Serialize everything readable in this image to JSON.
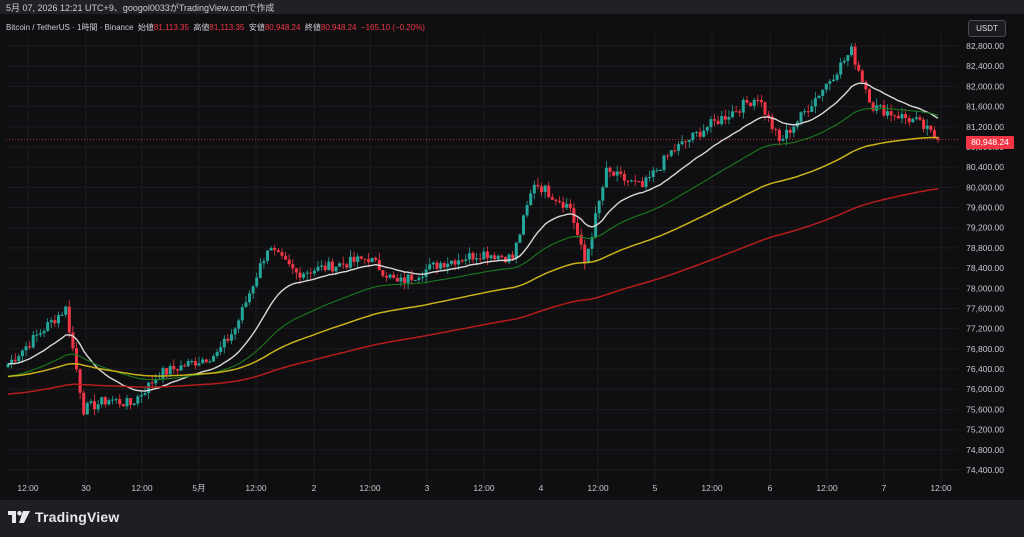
{
  "header": {
    "title": "5月 07, 2026 12:21 UTC+9、googol0033がTradingView.comで作成"
  },
  "legend": {
    "symbol": "Bitcoin / TetherUS · 1時間 · Binance",
    "open_label": "始値",
    "open_value": "81,113.35",
    "high_label": "高値",
    "high_value": "81,113.35",
    "low_label": "安値",
    "low_value": "80,948.24",
    "close_label": "終値",
    "close_value": "80,948.24",
    "change": "−165.10 (−0.20%)"
  },
  "currency_button": "USDT",
  "last_price_label": "80,948.24",
  "branding": {
    "name": "TradingView"
  },
  "colors": {
    "up": "#26a69a",
    "down": "#f23645",
    "ma_fast": "#d9d9d9",
    "ma_mid": "#1b7a1f",
    "ma_slow": "#c9b21a",
    "ma_long": "#b71c1c"
  },
  "chart_data": {
    "type": "candlestick",
    "title": "",
    "ylim": [
      74100,
      83100
    ],
    "y_ticks": [
      "82,800.00",
      "82,400.00",
      "82,000.00",
      "81,600.00",
      "81,200.00",
      "80,800.00",
      "80,400.00",
      "80,000.00",
      "79,600.00",
      "79,200.00",
      "78,800.00",
      "78,400.00",
      "78,000.00",
      "77,600.00",
      "77,200.00",
      "76,800.00",
      "76,400.00",
      "76,000.00",
      "75,600.00",
      "75,200.00",
      "74,800.00",
      "74,400.00"
    ],
    "x_ticks": [
      "12:00",
      "30",
      "12:00",
      "5月",
      "12:00",
      "2",
      "12:00",
      "3",
      "12:00",
      "4",
      "12:00",
      "5",
      "12:00",
      "6",
      "12:00",
      "7",
      "12:00"
    ],
    "last_price": 80948.24,
    "price_keypoints": [
      [
        0,
        76500
      ],
      [
        10,
        77200
      ],
      [
        16,
        77600
      ],
      [
        21,
        75600
      ],
      [
        28,
        75800
      ],
      [
        34,
        75700
      ],
      [
        42,
        76300
      ],
      [
        50,
        76500
      ],
      [
        58,
        76700
      ],
      [
        63,
        77200
      ],
      [
        72,
        78800
      ],
      [
        80,
        78300
      ],
      [
        94,
        78500
      ],
      [
        100,
        78600
      ],
      [
        108,
        78100
      ],
      [
        120,
        78500
      ],
      [
        132,
        78700
      ],
      [
        140,
        78600
      ],
      [
        146,
        80100
      ],
      [
        156,
        79600
      ],
      [
        160,
        78500
      ],
      [
        166,
        80300
      ],
      [
        176,
        80000
      ],
      [
        184,
        80700
      ],
      [
        194,
        81200
      ],
      [
        208,
        81800
      ],
      [
        214,
        80900
      ],
      [
        220,
        81400
      ],
      [
        234,
        82700
      ],
      [
        240,
        81600
      ],
      [
        252,
        81300
      ],
      [
        258,
        80950
      ]
    ],
    "series": [
      {
        "name": "",
        "type": "line",
        "period": 20
      },
      {
        "name": "",
        "type": "line",
        "period": 50
      },
      {
        "name": "",
        "type": "line",
        "period": 100
      },
      {
        "name": "",
        "type": "line",
        "period": 200
      }
    ],
    "grid": true
  }
}
